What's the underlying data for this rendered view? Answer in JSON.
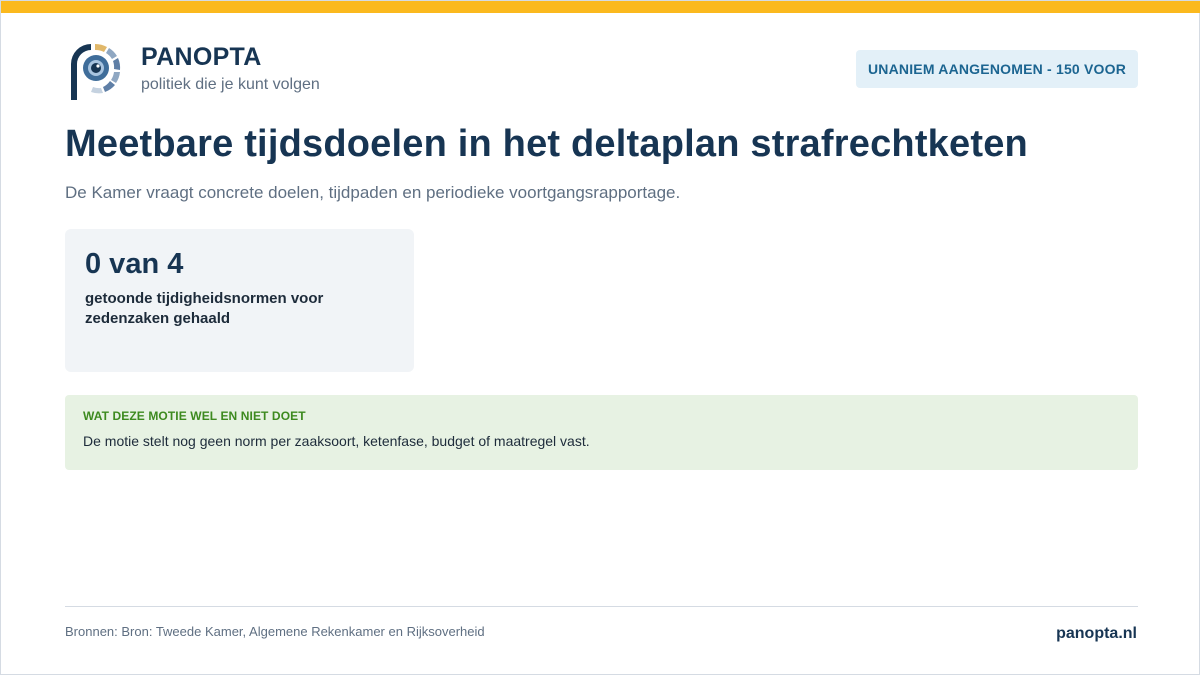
{
  "brand": {
    "name": "PANOPTA",
    "tagline": "politiek die je kunt volgen"
  },
  "status_badge": "UNANIEM AANGENOMEN - 150 VOOR",
  "title": "Meetbare tijdsdoelen in het deltaplan strafrechtketen",
  "subtitle": "De Kamer vraagt concrete doelen, tijdpaden en periodieke voortgangsrapportage.",
  "stat": {
    "value": "0 van 4",
    "label": "getoonde tijdigheidsnormen voor zedenzaken gehaald"
  },
  "note": {
    "heading": "WAT DEZE MOTIE WEL EN NIET DOET",
    "text": "De motie stelt nog geen norm per zaaksoort, ketenfase, budget of maatregel vast."
  },
  "footer": {
    "sources": "Bronnen: Bron: Tweede Kamer, Algemene Rekenkamer en Rijksoverheid",
    "url": "panopta.nl"
  },
  "colors": {
    "accent_bar": "#fbb91e",
    "brand_navy": "#173553",
    "badge_bg": "#e3f0f8",
    "badge_text": "#1c6591",
    "note_bg": "#e7f2e3",
    "note_heading": "#3d8a1f"
  },
  "icons": {
    "logo": "panopta-eye-p-logo"
  }
}
